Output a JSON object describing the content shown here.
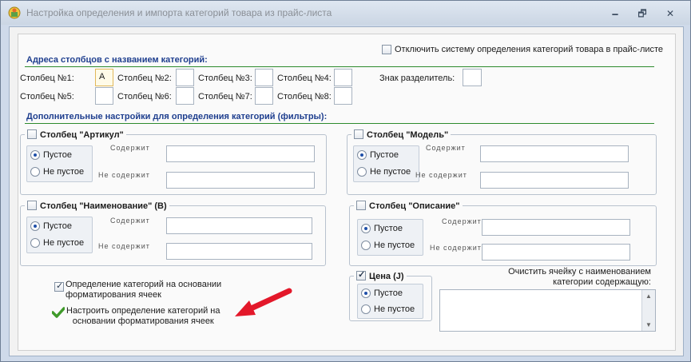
{
  "window": {
    "title": "Настройка определения и импорта категорий товара из прайс-листа"
  },
  "controls": {
    "minimize": "🗕",
    "restore": "🗗",
    "close": "✕"
  },
  "disable_checkbox": {
    "label": "Отключить систему определения категорий товара в прайс-листе"
  },
  "columns_section": {
    "title": "Адреса столбцов с названием категорий:",
    "col1": "Столбец №1:",
    "col1_value": "А",
    "col2": "Столбец №2:",
    "col3": "Столбец №3:",
    "col4": "Столбец №4:",
    "col5": "Столбец №5:",
    "col6": "Столбец №6:",
    "col7": "Столбец №7:",
    "col8": "Столбец №8:",
    "separator": "Знак разделитель:"
  },
  "filters_section": {
    "title": "Дополнительные настройки для определения категорий (фильтры):"
  },
  "common": {
    "empty": "Пустое",
    "not_empty": "Не пустое",
    "contains": "Содержит",
    "not_contains": "Не содержит"
  },
  "groups": {
    "article": "Столбец \"Артикул\"",
    "model": "Столбец \"Модель\"",
    "name": "Столбец \"Наименование\" (B)",
    "description": "Столбец \"Описание\"",
    "price": "Цена (J)"
  },
  "format_checkbox": {
    "label_line1": "Определение категорий на основании",
    "label_line2": "форматирования ячеек"
  },
  "format_link": {
    "line1": "Настроить определение категорий на",
    "line2": "основании форматирования ячеек"
  },
  "clear_cell": {
    "line1": "Очистить ячейку с наименованием",
    "line2": "категории содержащую:"
  },
  "colors": {
    "accent_title": "#1f3f8f",
    "divider": "#2e8b2e",
    "arrow": "#e3182a"
  }
}
